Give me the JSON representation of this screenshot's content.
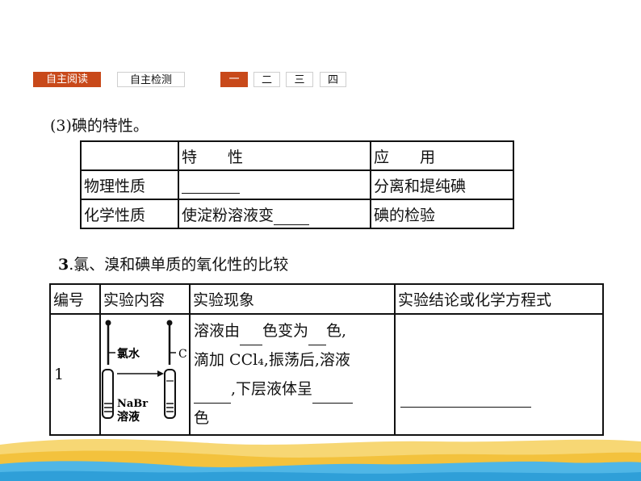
{
  "nav": {
    "tabs": [
      "自主阅读",
      "自主检测"
    ],
    "numbers": [
      "一",
      "二",
      "三",
      "四"
    ]
  },
  "subtitle": "(3)碘的特性。",
  "table1": {
    "header": [
      "",
      "特　　性",
      "应　　用"
    ],
    "rows": [
      {
        "label": "物理性质",
        "property": "",
        "use": "分离和提纯碘"
      },
      {
        "label": "化学性质",
        "property": "使淀粉溶液变",
        "use": "碘的检验"
      }
    ]
  },
  "section3": {
    "number": "3",
    "title": ".氯、溴和碘单质的氧化性的比较"
  },
  "table2": {
    "headers": [
      "编号",
      "实验内容",
      "实验现象",
      "实验结论或化学方程式"
    ],
    "row": {
      "number": "1",
      "diagram": {
        "reagent_top": "氯水",
        "reagent_bottom_1": "NaBr",
        "reagent_bottom_2": "溶液",
        "side_label": "C"
      },
      "observation": {
        "line1_a": "溶液由",
        "line1_b": "色变为",
        "line1_c": "色,",
        "line2": "滴加 CCl₄,振荡后,溶液",
        "line3": ",下层液体呈",
        "line4": "色"
      }
    }
  },
  "colors": {
    "accent": "#c8491a",
    "wave_light": "#f7d774",
    "wave_dark": "#f3c23d",
    "water": "#4fb6e6"
  }
}
